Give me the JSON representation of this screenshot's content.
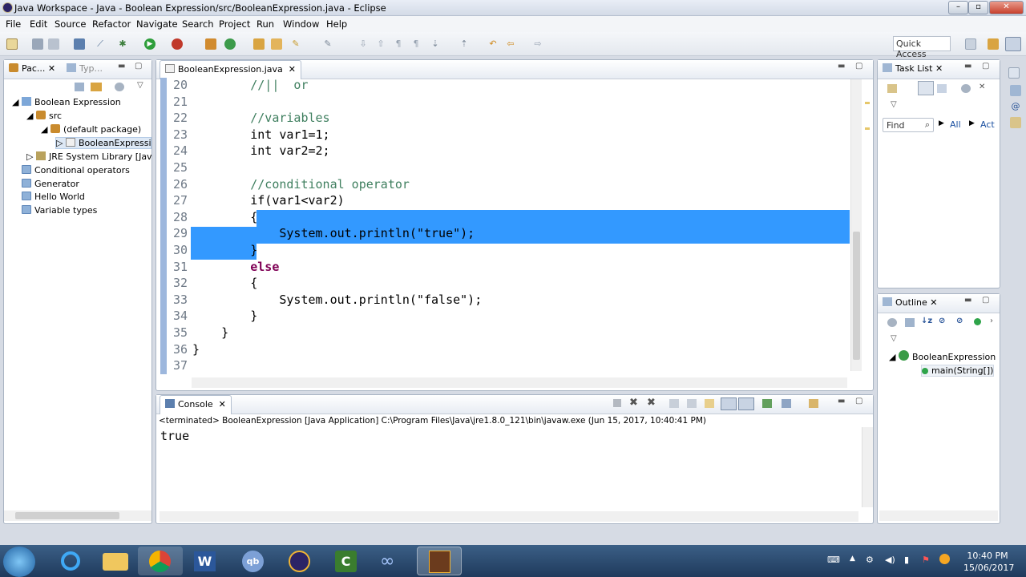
{
  "window": {
    "title": "Java Workspace - Java - Boolean Expression/src/BooleanExpression.java - Eclipse"
  },
  "menu": [
    "File",
    "Edit",
    "Source",
    "Refactor",
    "Navigate",
    "Search",
    "Project",
    "Run",
    "Window",
    "Help"
  ],
  "toolbar": {
    "quick_access": "Quick Access"
  },
  "left_panel": {
    "tab_package": "Pac...",
    "tab_type": "Typ...",
    "tree": [
      "Boolean Expression",
      "src",
      "(default package)",
      "BooleanExpression",
      "JRE System Library [JavaS",
      "Conditional operators",
      "Generator",
      "Hello World",
      "Variable types"
    ]
  },
  "editor": {
    "tab_label": "BooleanExpression.java",
    "lines": [
      {
        "n": "20",
        "t": "        //||  or"
      },
      {
        "n": "21",
        "t": ""
      },
      {
        "n": "22",
        "t": "        //variables"
      },
      {
        "n": "23",
        "t": "        int var1=1;"
      },
      {
        "n": "24",
        "t": "        int var2=2;"
      },
      {
        "n": "25",
        "t": ""
      },
      {
        "n": "26",
        "t": "        //conditional operator"
      },
      {
        "n": "27",
        "t": "        if(var1<var2)"
      },
      {
        "n": "28",
        "t": "        {"
      },
      {
        "n": "29",
        "t": "            System.out.println(\"true\");"
      },
      {
        "n": "30",
        "t": "        }"
      },
      {
        "n": "31",
        "t": "        else"
      },
      {
        "n": "32",
        "t": "        {"
      },
      {
        "n": "33",
        "t": "            System.out.println(\"false\");"
      },
      {
        "n": "34",
        "t": "        }"
      },
      {
        "n": "35",
        "t": "    }"
      },
      {
        "n": "36",
        "t": "}"
      },
      {
        "n": "37",
        "t": ""
      }
    ]
  },
  "console": {
    "tab_label": "Console",
    "status": "<terminated> BooleanExpression [Java Application] C:\\Program Files\\Java\\jre1.8.0_121\\bin\\javaw.exe (Jun 15, 2017, 10:40:41 PM)",
    "output": "true"
  },
  "task_list": {
    "tab_label": "Task List",
    "find_placeholder": "Find",
    "all": "All",
    "act": "Act"
  },
  "outline": {
    "tab_label": "Outline",
    "class_name": "BooleanExpression",
    "method": "main(String[])"
  },
  "taskbar": {
    "time": "10:40 PM",
    "date": "15/06/2017"
  },
  "colors": {
    "selection": "#3399ff",
    "keyword": "#7f0055",
    "comment": "#3f7f5f",
    "string": "#2a00ff"
  }
}
